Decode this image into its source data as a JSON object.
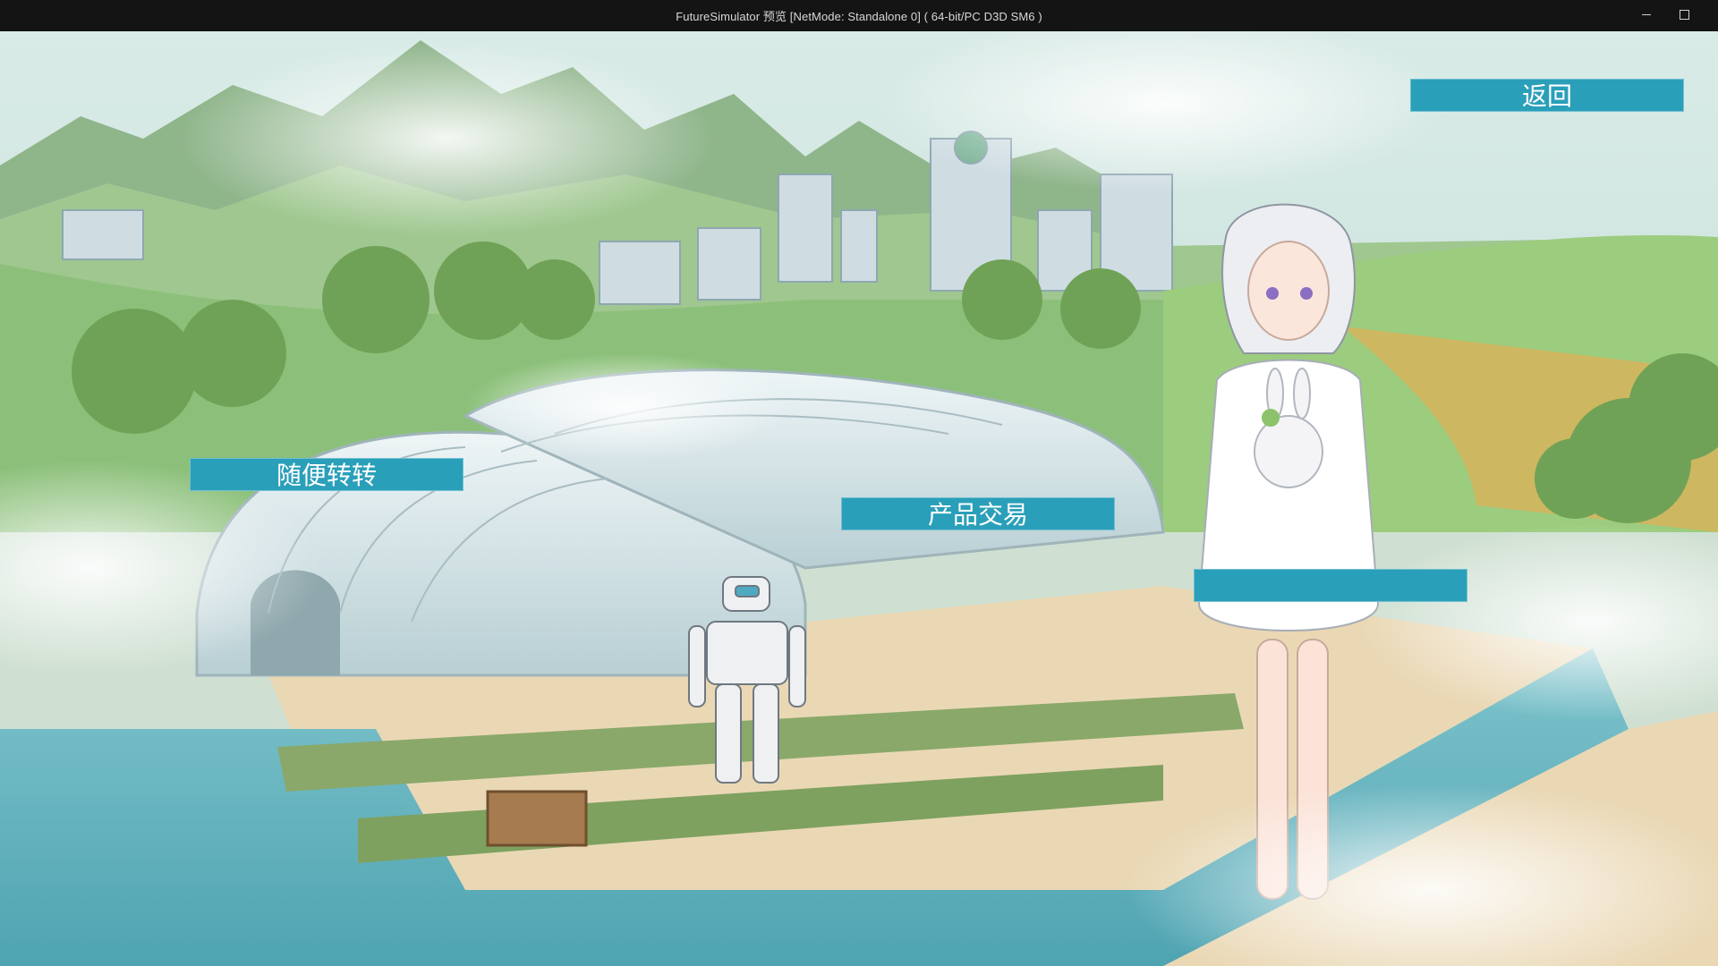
{
  "window": {
    "title": "FutureSimulator 预览 [NetMode: Standalone 0]  ( 64-bit/PC D3D SM6 )",
    "minimize_icon": "minimize-icon",
    "maximize_icon": "maximize-icon"
  },
  "menu": {
    "back_label": "返回",
    "wander_label": "随便转转",
    "trade_label": "产品交易",
    "hidden_label": ""
  },
  "colors": {
    "button": "#2a9fb9",
    "titlebar": "#141414",
    "sky": "#cfe3df",
    "water": "#5fb1bd"
  },
  "scene": {
    "background": "anime-farm-greenhouse-scene",
    "characters": [
      "white-haired-girl-with-rabbit",
      "white-robot"
    ]
  }
}
